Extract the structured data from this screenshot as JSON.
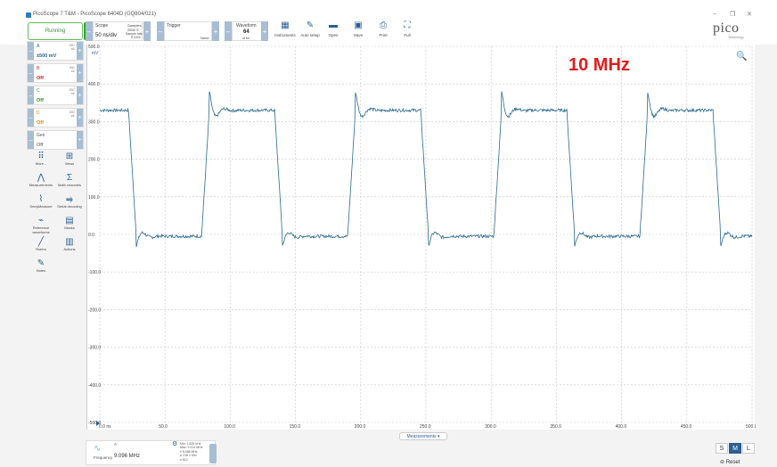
{
  "window": {
    "title": "PicoScope 7 T&M - PicoScope 6404D (GQ804/021)",
    "min": "–",
    "restore": "❐",
    "close": "✕"
  },
  "toolbar": {
    "run_label": "Running",
    "scope": {
      "title": "Scope",
      "samples_label": "Samples",
      "samples_value": "2500 S",
      "rate_label": "Sample rate",
      "rate_value": "5 GS/s",
      "timebase": "50 ns/div"
    },
    "trigger": {
      "title": "Trigger",
      "mode": "None"
    },
    "waveform": {
      "title": "Waveform",
      "index": "64",
      "of": "of 64"
    },
    "tools": [
      {
        "id": "instruments",
        "label": "Instruments",
        "icon": "▦"
      },
      {
        "id": "auto-setup",
        "label": "Auto setup",
        "icon": "✎"
      },
      {
        "id": "open",
        "label": "Open",
        "icon": "▬"
      },
      {
        "id": "save",
        "label": "Save",
        "icon": "▣"
      },
      {
        "id": "print",
        "label": "Print",
        "icon": "⎙"
      },
      {
        "id": "full",
        "label": "Full",
        "icon": "⛶"
      }
    ],
    "logo": "pico",
    "logo_sub": "Technology"
  },
  "channels": [
    {
      "name": "A",
      "coupling": "DC",
      "probe": "x1",
      "value": "±500 mV",
      "color": "#2b5f95"
    },
    {
      "name": "B",
      "coupling": "DC",
      "probe": "x1",
      "value": "Off",
      "color": "#d42020"
    },
    {
      "name": "C",
      "coupling": "DC",
      "probe": "x1",
      "value": "Off",
      "color": "#2a9a2a"
    },
    {
      "name": "D",
      "coupling": "DC",
      "probe": "x1",
      "value": "Off",
      "color": "#e08a00"
    },
    {
      "name": "Gen",
      "coupling": "",
      "probe": "",
      "value": "Off",
      "color": "#555555"
    }
  ],
  "side_tools": [
    {
      "label": "More...",
      "icon": "⠿"
    },
    {
      "label": "Views",
      "icon": "⊞"
    },
    {
      "label": "Measurements",
      "icon": "⋀"
    },
    {
      "label": "Math channels",
      "icon": "Σ"
    },
    {
      "label": "DeepMeasure",
      "icon": "⌇"
    },
    {
      "label": "Serial decoding",
      "icon": "⥤"
    },
    {
      "label": "Reference waveforms",
      "icon": "⌁"
    },
    {
      "label": "Masks",
      "icon": "▤"
    },
    {
      "label": "Rulers",
      "icon": "╱"
    },
    {
      "label": "Actions",
      "icon": "▥"
    },
    {
      "label": "Notes",
      "icon": "✎"
    }
  ],
  "plot": {
    "y_unit": "mV",
    "y_ticks": [
      "500.0",
      "400.0",
      "300.0",
      "200.0",
      "100.0",
      "0.0",
      "-100.0",
      "-200.0",
      "-300.0",
      "-400.0",
      "-500.0"
    ],
    "x_ticks": [
      "0.0 ns",
      "50.0",
      "100.0",
      "150.0",
      "200.0",
      "250.0",
      "300.0",
      "350.0",
      "400.0",
      "450.0",
      "500.0"
    ],
    "annotation": "10 MHz",
    "trace_color": "#2b6a8f",
    "signal": {
      "high_mv": 330,
      "low_mv": -5,
      "period_ns": 112,
      "first_fall_ns": 22,
      "overshoot_mv": 380,
      "undershoot_mv": -30
    }
  },
  "measurements": {
    "tab_label": "Measurements ▾",
    "channel": "A",
    "name": "Frequency",
    "value": "9.096 MHz",
    "stats": [
      "Min.  1.825 kHz",
      "Max.  9.124 MHz",
      "x̄   8.068 MHz",
      "σ    218.1 kHz",
      "n    812"
    ]
  },
  "view_size": {
    "s": "S",
    "m": "M",
    "l": "L",
    "reset": "Reset"
  }
}
